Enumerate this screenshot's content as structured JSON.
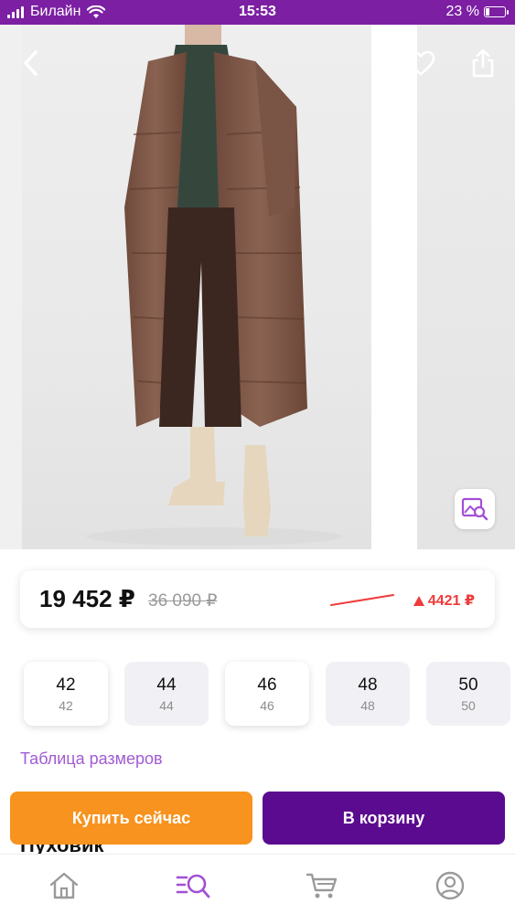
{
  "status_bar": {
    "carrier": "Билайн",
    "time": "15:53",
    "battery_percent": "23 %",
    "battery_level": 0.23
  },
  "gallery": {
    "back_icon": "chevron-left-icon",
    "favorite_icon": "heart-outline-icon",
    "share_icon": "share-icon",
    "photo_search_icon": "image-search-icon"
  },
  "price": {
    "current": "19 452 ₽",
    "old": "36 090 ₽",
    "change": "4421 ₽",
    "change_icon": "triangle-up-icon",
    "accent_color": "#ef3b3b"
  },
  "sizes": [
    {
      "ru": "42",
      "eu": "42",
      "selected": true
    },
    {
      "ru": "44",
      "eu": "44",
      "selected": false
    },
    {
      "ru": "46",
      "eu": "46",
      "selected": true
    },
    {
      "ru": "48",
      "eu": "48",
      "selected": false
    },
    {
      "ru": "50",
      "eu": "50",
      "selected": false
    }
  ],
  "size_table_link": "Таблица размеров",
  "product_title": "Пуховик",
  "actions": {
    "buy_now": "Купить сейчас",
    "add_to_cart": "В корзину",
    "buy_color": "#f7931e",
    "cart_color": "#5b0b8f"
  },
  "bottom_nav": {
    "items": [
      "home-icon",
      "catalog-search-icon",
      "cart-icon",
      "profile-icon"
    ],
    "active_color": "#a24fd6",
    "inactive_color": "#9a9a9a"
  }
}
